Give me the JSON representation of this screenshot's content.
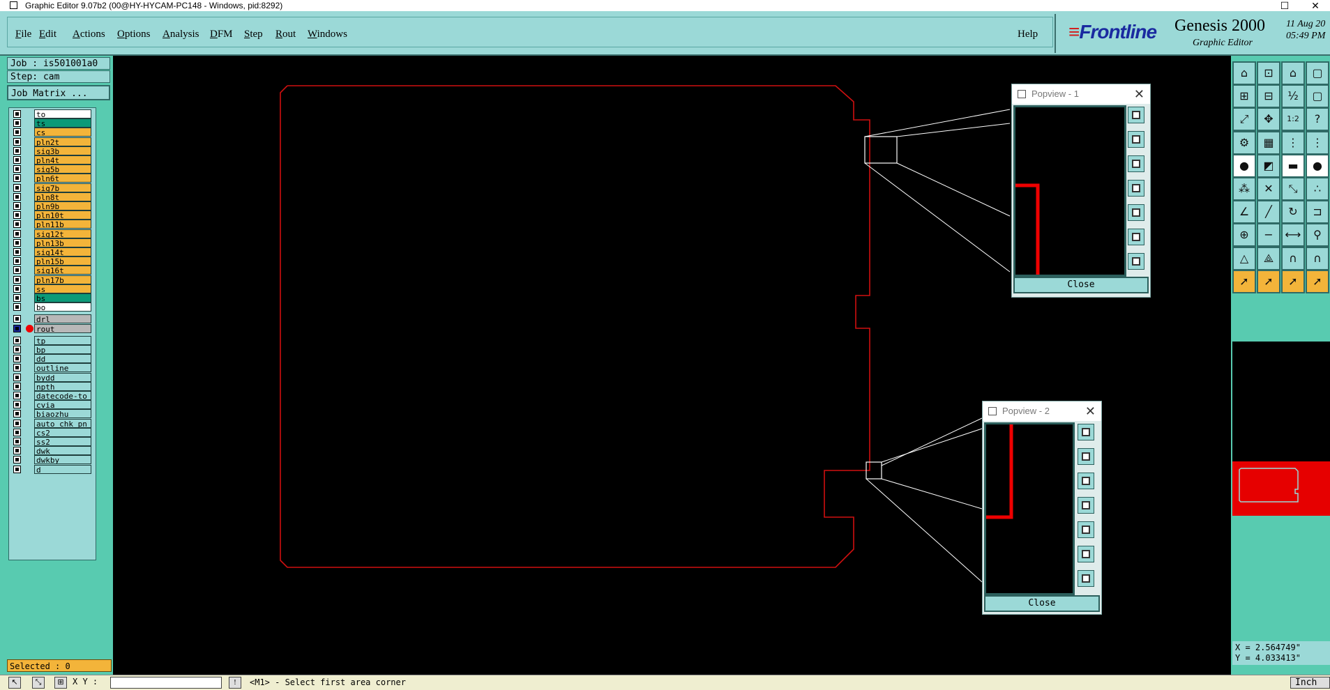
{
  "window": {
    "title": "Graphic Editor 9.07b2 (00@HY-HYCAM-PC148 - Windows, pid:8292)",
    "maximize_glyph": "☐",
    "close_glyph": "✕"
  },
  "menu": {
    "items": [
      {
        "label": "File",
        "mnemonic": "F",
        "rest": "ile"
      },
      {
        "label": "Edit",
        "mnemonic": "E",
        "rest": "dit"
      },
      {
        "label": "Actions",
        "mnemonic": "A",
        "rest": "ctions"
      },
      {
        "label": "Options",
        "mnemonic": "O",
        "rest": "ptions"
      },
      {
        "label": "Analysis",
        "mnemonic": "A",
        "rest": "nalysis"
      },
      {
        "label": "DFM",
        "mnemonic": "D",
        "rest": "FM"
      },
      {
        "label": "Step",
        "mnemonic": "S",
        "rest": "tep"
      },
      {
        "label": "Rout",
        "mnemonic": "R",
        "rest": "out"
      },
      {
        "label": "Windows",
        "mnemonic": "W",
        "rest": "indows"
      }
    ],
    "help": "Help"
  },
  "brand": {
    "logo": "Frontline",
    "product": "Genesis 2000",
    "subtitle": "Graphic Editor",
    "date": "11 Aug 20\n05:49 PM"
  },
  "left": {
    "job": "Job : is501001a0",
    "step": "Step: cam",
    "job_matrix": "Job Matrix ...",
    "selected": "Selected : 0",
    "layers": [
      {
        "name": "to",
        "color": "#ffffff",
        "group": 0
      },
      {
        "name": "ts",
        "color": "#0c9a78",
        "group": 0
      },
      {
        "name": "cs",
        "color": "#f3b43a",
        "group": 0
      },
      {
        "name": "pln2t",
        "color": "#f3b43a",
        "group": 0
      },
      {
        "name": "sig3b",
        "color": "#f3b43a",
        "group": 0
      },
      {
        "name": "pln4t",
        "color": "#f3b43a",
        "group": 0
      },
      {
        "name": "sig5b",
        "color": "#f3b43a",
        "group": 0
      },
      {
        "name": "pln6t",
        "color": "#f3b43a",
        "group": 0
      },
      {
        "name": "sig7b",
        "color": "#f3b43a",
        "group": 0
      },
      {
        "name": "pln8t",
        "color": "#f3b43a",
        "group": 0
      },
      {
        "name": "pln9b",
        "color": "#f3b43a",
        "group": 0
      },
      {
        "name": "pln10t",
        "color": "#f3b43a",
        "group": 0
      },
      {
        "name": "pln11b",
        "color": "#f3b43a",
        "group": 0
      },
      {
        "name": "sig12t",
        "color": "#f3b43a",
        "group": 0
      },
      {
        "name": "pln13b",
        "color": "#f3b43a",
        "group": 0
      },
      {
        "name": "sig14t",
        "color": "#f3b43a",
        "group": 0
      },
      {
        "name": "pln15b",
        "color": "#f3b43a",
        "group": 0
      },
      {
        "name": "sig16t",
        "color": "#f3b43a",
        "group": 0
      },
      {
        "name": "pln17b",
        "color": "#f3b43a",
        "group": 0
      },
      {
        "name": "ss",
        "color": "#f3b43a",
        "group": 0
      },
      {
        "name": "bs",
        "color": "#0c9a78",
        "group": 0
      },
      {
        "name": "bo",
        "color": "#ffffff",
        "group": 0
      },
      {
        "name": "drl",
        "color": "#b8b8b8",
        "group": 1
      },
      {
        "name": "rout",
        "color": "#b8b8b8",
        "group": 1,
        "active": true
      },
      {
        "name": "tp",
        "color": "#9bd9d7",
        "group": 2
      },
      {
        "name": "bp",
        "color": "#9bd9d7",
        "group": 2
      },
      {
        "name": "dd",
        "color": "#9bd9d7",
        "group": 2
      },
      {
        "name": "outline",
        "color": "#9bd9d7",
        "group": 2
      },
      {
        "name": "bydd",
        "color": "#9bd9d7",
        "group": 2
      },
      {
        "name": "npth",
        "color": "#9bd9d7",
        "group": 2
      },
      {
        "name": "datecode-to",
        "color": "#9bd9d7",
        "group": 2
      },
      {
        "name": "cvia",
        "color": "#9bd9d7",
        "group": 2
      },
      {
        "name": "biaozhu",
        "color": "#9bd9d7",
        "group": 2
      },
      {
        "name": "auto_chk_pn",
        "color": "#9bd9d7",
        "group": 2
      },
      {
        "name": "cs2",
        "color": "#9bd9d7",
        "group": 2
      },
      {
        "name": "ss2",
        "color": "#9bd9d7",
        "group": 2
      },
      {
        "name": "dwk",
        "color": "#9bd9d7",
        "group": 2
      },
      {
        "name": "dwkby",
        "color": "#9bd9d7",
        "group": 2
      },
      {
        "name": "d",
        "color": "#9bd9d7",
        "group": 2
      }
    ]
  },
  "popview1": {
    "title": "Popview - 1",
    "close_glyph": "✕",
    "close_label": "Close"
  },
  "popview2": {
    "title": "Popview - 2",
    "close_glyph": "✕",
    "close_label": "Close"
  },
  "right": {
    "coords": "X = 2.564749\"\nY = 4.033413\"",
    "tools": [
      {
        "name": "home-icon",
        "glyph": "⌂",
        "style": ""
      },
      {
        "name": "zoom-home-icon",
        "glyph": "⊡",
        "style": ""
      },
      {
        "name": "house-icon",
        "glyph": "⌂",
        "style": ""
      },
      {
        "name": "extra-icon",
        "glyph": "▢",
        "style": ""
      },
      {
        "name": "zoom-in-icon",
        "glyph": "⊞",
        "style": ""
      },
      {
        "name": "zoom-out-icon",
        "glyph": "⊟",
        "style": ""
      },
      {
        "name": "pan-icon",
        "glyph": "½",
        "style": ""
      },
      {
        "name": "extra2-icon",
        "glyph": "▢",
        "style": ""
      },
      {
        "name": "fit-icon",
        "glyph": "⤢",
        "style": ""
      },
      {
        "name": "center-icon",
        "glyph": "✥",
        "style": ""
      },
      {
        "name": "scale-icon",
        "glyph": "1:2",
        "style": ""
      },
      {
        "name": "help-icon",
        "glyph": "?",
        "style": ""
      },
      {
        "name": "tools-icon",
        "glyph": "⚙",
        "style": ""
      },
      {
        "name": "grid-icon",
        "glyph": "▦",
        "style": ""
      },
      {
        "name": "snap-icon",
        "glyph": "⋮",
        "style": ""
      },
      {
        "name": "snap2-icon",
        "glyph": "⋮",
        "style": ""
      },
      {
        "name": "pad-icon",
        "glyph": "●",
        "style": "w"
      },
      {
        "name": "line-icon",
        "glyph": "◩",
        "style": ""
      },
      {
        "name": "scale-bar-icon",
        "glyph": "▬",
        "style": "w"
      },
      {
        "name": "circle-icon",
        "glyph": "●",
        "style": "w"
      },
      {
        "name": "nodes-icon",
        "glyph": "⁂",
        "style": ""
      },
      {
        "name": "cross-icon",
        "glyph": "✕",
        "style": ""
      },
      {
        "name": "connect-icon",
        "glyph": "⤡",
        "style": ""
      },
      {
        "name": "dots-icon",
        "glyph": "∴",
        "style": ""
      },
      {
        "name": "angle-icon",
        "glyph": "∠",
        "style": ""
      },
      {
        "name": "slash-icon",
        "glyph": "╱",
        "style": ""
      },
      {
        "name": "rotate-icon",
        "glyph": "↻",
        "style": ""
      },
      {
        "name": "bracket-icon",
        "glyph": "⊐",
        "style": ""
      },
      {
        "name": "move-icon",
        "glyph": "⊕",
        "style": ""
      },
      {
        "name": "minus-icon",
        "glyph": "−",
        "style": ""
      },
      {
        "name": "measure-icon",
        "glyph": "⟷",
        "style": ""
      },
      {
        "name": "link-icon",
        "glyph": "⚲",
        "style": ""
      },
      {
        "name": "triangle-icon",
        "glyph": "△",
        "style": ""
      },
      {
        "name": "triangle2-icon",
        "glyph": "⟁",
        "style": ""
      },
      {
        "name": "arch-icon",
        "glyph": "∩",
        "style": ""
      },
      {
        "name": "arch2-icon",
        "glyph": "∩",
        "style": ""
      },
      {
        "name": "cursor-icon",
        "glyph": "➚",
        "style": "y"
      },
      {
        "name": "cursor-select-icon",
        "glyph": "➚",
        "style": "y"
      },
      {
        "name": "cursor-circle-icon",
        "glyph": "➚",
        "style": "y"
      },
      {
        "name": "cursor-extra-icon",
        "glyph": "➚",
        "style": "y"
      }
    ]
  },
  "status": {
    "xy_label": "X Y :",
    "xy_value": "",
    "message": "<M1> - Select first area corner",
    "units": "Inch"
  }
}
